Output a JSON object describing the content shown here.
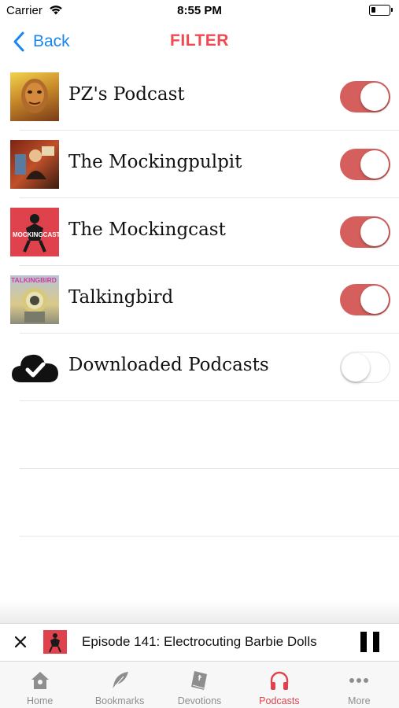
{
  "status_bar": {
    "carrier": "Carrier",
    "time": "8:55 PM",
    "battery_level": 0.15
  },
  "nav": {
    "back_label": "Back",
    "title": "FILTER",
    "accent_color": "#ef4a51",
    "link_color": "#1a86f0"
  },
  "filters": [
    {
      "label": "PZ's Podcast",
      "enabled": true,
      "thumbnail_text": ""
    },
    {
      "label": "The Mockingpulpit",
      "enabled": true,
      "thumbnail_text": ""
    },
    {
      "label": "The Mockingcast",
      "enabled": true,
      "thumbnail_text": "MOCKINGCAST"
    },
    {
      "label": "Talkingbird",
      "enabled": true,
      "thumbnail_text": "TALKINGBIRD"
    },
    {
      "label": "Downloaded Podcasts",
      "enabled": false,
      "icon": "cloud-check-icon"
    }
  ],
  "toggle_on_color": "#d45f5d",
  "player": {
    "episode_title": "Episode 141: Electrocuting Barbie Dolls",
    "state": "playing"
  },
  "tabs": [
    {
      "label": "Home",
      "icon": "home-icon",
      "active": false
    },
    {
      "label": "Bookmarks",
      "icon": "feather-icon",
      "active": false
    },
    {
      "label": "Devotions",
      "icon": "book-icon",
      "active": false
    },
    {
      "label": "Podcasts",
      "icon": "headphones-icon",
      "active": true
    },
    {
      "label": "More",
      "icon": "more-icon",
      "active": false
    }
  ],
  "tab_active_color": "#e0424d"
}
